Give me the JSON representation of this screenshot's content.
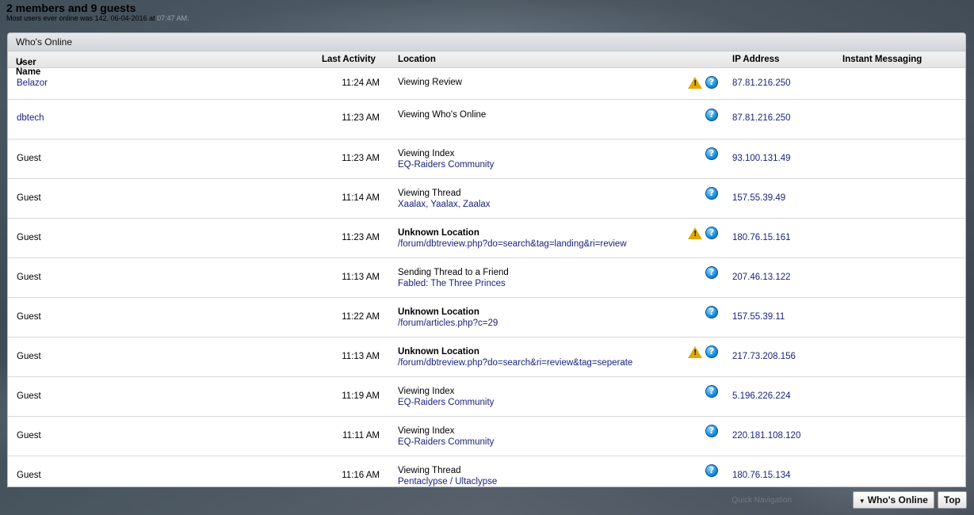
{
  "header": {
    "title": "2 members and 9 guests",
    "subtitle": "Most users ever online was 142, 06-04-2016 at",
    "subtitle_time": "07:47 AM."
  },
  "panel": {
    "title": "Who's Online",
    "columns": {
      "user": "User Name",
      "activity": "Last Activity",
      "location": "Location",
      "ip": "IP Address",
      "im": "Instant Messaging"
    }
  },
  "rows": [
    {
      "user": "Belazor",
      "member": true,
      "time": "11:24 AM",
      "action": "Viewing Review",
      "bold": false,
      "target": "",
      "warn": true,
      "ip": "87.81.216.250"
    },
    {
      "user": "dbtech",
      "member": true,
      "time": "11:23 AM",
      "action": "Viewing Who's Online",
      "bold": false,
      "target": "",
      "warn": false,
      "ip": "87.81.216.250"
    },
    {
      "user": "Guest",
      "member": false,
      "time": "11:23 AM",
      "action": "Viewing Index",
      "bold": false,
      "target": "EQ-Raiders Community",
      "warn": false,
      "ip": "93.100.131.49"
    },
    {
      "user": "Guest",
      "member": false,
      "time": "11:14 AM",
      "action": "Viewing Thread",
      "bold": false,
      "target": "Xaalax, Yaalax, Zaalax",
      "warn": false,
      "ip": "157.55.39.49"
    },
    {
      "user": "Guest",
      "member": false,
      "time": "11:23 AM",
      "action": "Unknown Location",
      "bold": true,
      "target": "/forum/dbtreview.php?do=search&tag=landing&ri=review",
      "warn": true,
      "ip": "180.76.15.161"
    },
    {
      "user": "Guest",
      "member": false,
      "time": "11:13 AM",
      "action": "Sending Thread to a Friend",
      "bold": false,
      "target": "Fabled: The Three Princes",
      "warn": false,
      "ip": "207.46.13.122"
    },
    {
      "user": "Guest",
      "member": false,
      "time": "11:22 AM",
      "action": "Unknown Location",
      "bold": true,
      "target": "/forum/articles.php?c=29",
      "warn": false,
      "ip": "157.55.39.11"
    },
    {
      "user": "Guest",
      "member": false,
      "time": "11:13 AM",
      "action": "Unknown Location",
      "bold": true,
      "target": "/forum/dbtreview.php?do=search&ri=review&tag=seperate",
      "warn": true,
      "ip": "217.73.208.156"
    },
    {
      "user": "Guest",
      "member": false,
      "time": "11:19 AM",
      "action": "Viewing Index",
      "bold": false,
      "target": "EQ-Raiders Community",
      "warn": false,
      "ip": "5.196.226.224"
    },
    {
      "user": "Guest",
      "member": false,
      "time": "11:11 AM",
      "action": "Viewing Index",
      "bold": false,
      "target": "EQ-Raiders Community",
      "warn": false,
      "ip": "220.181.108.120"
    },
    {
      "user": "Guest",
      "member": false,
      "time": "11:16 AM",
      "action": "Viewing Thread",
      "bold": false,
      "target": "Pentaclypse / Ultaclypse",
      "warn": false,
      "ip": "180.76.15.134"
    }
  ],
  "footer": {
    "quick_nav": "Quick Navigation",
    "whos_online_btn": "Who's Online",
    "top_btn": "Top"
  },
  "icons": {
    "sort": "sort-ascending-icon",
    "warning": "warning-icon",
    "help": "question-icon",
    "dropdown": "dropdown-triangle-icon"
  }
}
